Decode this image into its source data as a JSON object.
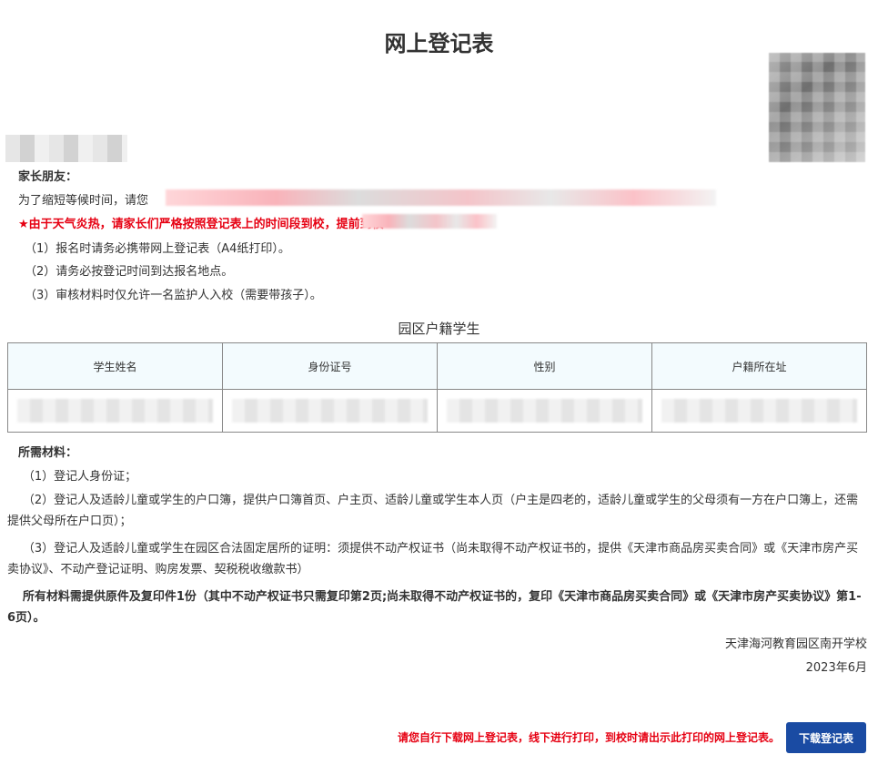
{
  "title": "网上登记表",
  "notice": {
    "greeting": "家长朋友：",
    "intro": "为了缩短等候时间，请您",
    "warning": "★由于天气炎热，请家长们严格按照登记表上的时间段到校，提前到校",
    "items": [
      "（1）报名时请务必携带网上登记表（A4纸打印）。",
      "（2）请务必按登记时间到达报名地点。",
      "（3）审核材料时仅允许一名监护人入校（需要带孩子）。"
    ]
  },
  "table": {
    "caption": "园区户籍学生",
    "headers": [
      "学生姓名",
      "身份证号",
      "性别",
      "户籍所在址"
    ]
  },
  "materials": {
    "heading": "所需材料：",
    "item1": "（1）登记人身份证；",
    "item2": "（2）登记人及适龄儿童或学生的户口簿，提供户口簿首页、户主页、适龄儿童或学生本人页（户主是四老的，适龄儿童或学生的父母须有一方在户口簿上，还需提供父母所在户口页）；",
    "item3": "（3）登记人及适龄儿童或学生在园区合法固定居所的证明：须提供不动产权证书（尚未取得不动产权证书的，提供《天津市商品房买卖合同》或《天津市房产买卖协议》、不动产登记证明、购房发票、契税税收缴款书）",
    "note": "所有材料需提供原件及复印件1份（其中不动产权证书只需复印第2页;尚未取得不动产权证书的，复印《天津市商品房买卖合同》或《天津市房产买卖协议》第1-6页）。"
  },
  "signature": {
    "org": "天津海河教育园区南开学校",
    "date": "2023年6月"
  },
  "footer": {
    "note": "请您自行下载网上登记表，线下进行打印，到校时请出示此打印的网上登记表。",
    "download_label": "下载登记表"
  },
  "colors": {
    "accent_red": "#e60012",
    "button_blue": "#1a4ba3",
    "table_header_bg": "#f3fbfe"
  }
}
